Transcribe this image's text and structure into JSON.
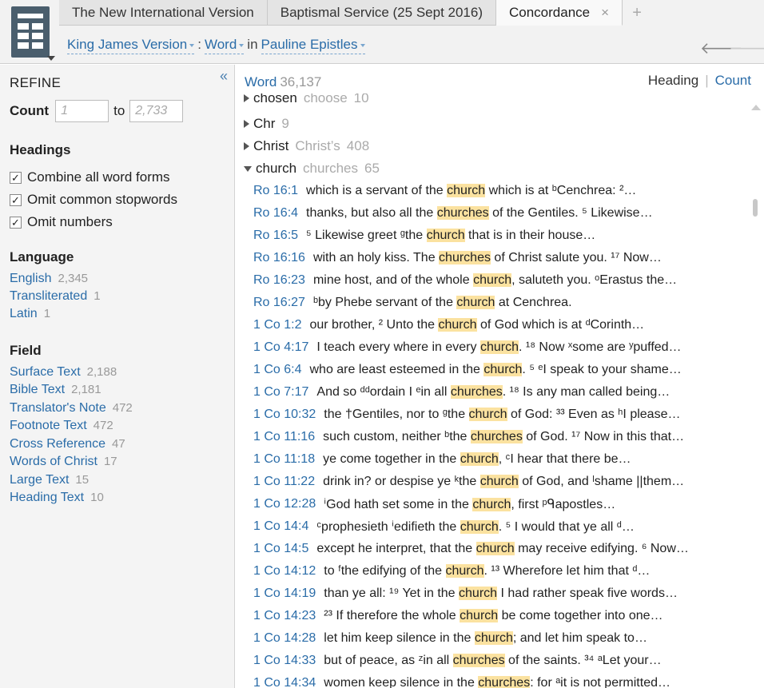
{
  "tabs": [
    {
      "label": "The New International Version"
    },
    {
      "label": "Baptismal Service (25 Sept 2016)"
    },
    {
      "label": "Concordance",
      "close": "×"
    }
  ],
  "tab_add": "+",
  "breadcrumb": {
    "version": "King James Version",
    "sep1": ":",
    "type": "Word",
    "sep2": "in",
    "scope": "Pauline Epistles"
  },
  "nav": {
    "back": "🡐",
    "forward": "🡒"
  },
  "sidebar": {
    "collapse": "«",
    "title": "REFINE",
    "count_label": "Count",
    "count_from_placeholder": "1",
    "count_to_label": "to",
    "count_to_placeholder": "2,733",
    "headings_title": "Headings",
    "options": [
      {
        "label": "Combine all word forms",
        "mark": "✓"
      },
      {
        "label": "Omit common stopwords",
        "mark": "✓"
      },
      {
        "label": "Omit numbers",
        "mark": "✓"
      }
    ],
    "language_title": "Language",
    "languages": [
      {
        "label": "English",
        "count": "2,345"
      },
      {
        "label": "Transliterated",
        "count": "1"
      },
      {
        "label": "Latin",
        "count": "1"
      }
    ],
    "field_title": "Field",
    "fields": [
      {
        "label": "Surface Text",
        "count": "2,188"
      },
      {
        "label": "Bible Text",
        "count": "2,181"
      },
      {
        "label": "Translator's Note",
        "count": "472"
      },
      {
        "label": "Footnote Text",
        "count": "472"
      },
      {
        "label": "Cross Reference",
        "count": "47"
      },
      {
        "label": "Words of Christ",
        "count": "17"
      },
      {
        "label": "Large Text",
        "count": "15"
      },
      {
        "label": "Heading Text",
        "count": "10"
      }
    ]
  },
  "main": {
    "head_label": "Word",
    "head_count": "36,137",
    "view_heading": "Heading",
    "view_sep": "|",
    "view_count": "Count"
  },
  "words": [
    {
      "word": "chosen",
      "alt": "choose",
      "count": "10"
    },
    {
      "word": "Chr",
      "alt": "",
      "count": "9"
    },
    {
      "word": "Christ",
      "alt": "Christ’s",
      "count": "408"
    },
    {
      "word": "church",
      "alt": "churches",
      "count": "65"
    }
  ],
  "refs": [
    {
      "ref": "Ro 16:1",
      "pre": "which is a servant of the ",
      "hl": "church",
      "post": " which is at ᵇCenchrea: ²…"
    },
    {
      "ref": "Ro 16:4",
      "pre": "thanks, but also all the ",
      "hl": "churches",
      "post": " of the Gentiles. ⁵ Likewise…"
    },
    {
      "ref": "Ro 16:5",
      "pre": "⁵ Likewise greet ᵍthe ",
      "hl": "church",
      "post": " that is in their house…"
    },
    {
      "ref": "Ro 16:16",
      "pre": "with an holy kiss. The ",
      "hl": "churches",
      "post": " of Christ salute you. ¹⁷ Now…"
    },
    {
      "ref": "Ro 16:23",
      "pre": "mine host, and of the whole ",
      "hl": "church",
      "post": ", saluteth you. ᵒErastus the…"
    },
    {
      "ref": "Ro 16:27",
      "pre": "ᵇby Phebe servant of the ",
      "hl": "church",
      "post": " at Cenchrea."
    },
    {
      "ref": "1 Co 1:2",
      "pre": "our brother, ² Unto the ",
      "hl": "church",
      "post": " of God which is at ᵈCorinth…"
    },
    {
      "ref": "1 Co 4:17",
      "pre": "I teach every where in every ",
      "hl": "church",
      "post": ". ¹⁸ Now ˣsome are ʸpuffed…"
    },
    {
      "ref": "1 Co 6:4",
      "pre": "who are least esteemed in the ",
      "hl": "church",
      "post": ". ⁵ ᵉI speak to your shame…"
    },
    {
      "ref": "1 Co 7:17",
      "pre": "And so ᵈᵈordain I ᵉin all ",
      "hl": "churches",
      "post": ". ¹⁸ Is any man called being…"
    },
    {
      "ref": "1 Co 10:32",
      "pre": "the †Gentiles, nor to ᵍthe ",
      "hl": "church",
      "post": " of God: ³³ Even as ʰI please…"
    },
    {
      "ref": "1 Co 11:16",
      "pre": "such custom, neither ᵇthe ",
      "hl": "churches",
      "post": " of God. ¹⁷ Now in this that…"
    },
    {
      "ref": "1 Co 11:18",
      "pre": "ye come together in the ",
      "hl": "church",
      "post": ", ᶜI hear that there be…"
    },
    {
      "ref": "1 Co 11:22",
      "pre": "drink in? or despise ye ᵏthe ",
      "hl": "church",
      "post": " of God, and ˡshame ||them…"
    },
    {
      "ref": "1 Co 12:28",
      "pre": "ⁱGod hath set some in the ",
      "hl": "church",
      "post": ", first ᵖᑫapostles…"
    },
    {
      "ref": "1 Co 14:4",
      "pre": "ᶜprophesieth ⁱedifieth the ",
      "hl": "church",
      "post": ". ⁵ I would that ye all ᵈ…"
    },
    {
      "ref": "1 Co 14:5",
      "pre": "except he interpret, that the ",
      "hl": "church",
      "post": " may receive edifying. ⁶ Now…"
    },
    {
      "ref": "1 Co 14:12",
      "pre": "to ᶠthe edifying of the ",
      "hl": "church",
      "post": ". ¹³ Wherefore let him that ᵈ…"
    },
    {
      "ref": "1 Co 14:19",
      "pre": "than ye all: ¹⁹ Yet in the ",
      "hl": "church",
      "post": " I had rather speak five words…"
    },
    {
      "ref": "1 Co 14:23",
      "pre": "²³ If therefore the whole ",
      "hl": "church",
      "post": " be come together into one…"
    },
    {
      "ref": "1 Co 14:28",
      "pre": "let him keep silence in the ",
      "hl": "church",
      "post": "; and let him speak to…"
    },
    {
      "ref": "1 Co 14:33",
      "pre": "but of peace, as ᶻin all ",
      "hl": "churches",
      "post": " of the saints. ³⁴ ᵃLet your…"
    },
    {
      "ref": "1 Co 14:34",
      "pre": "women keep silence in the ",
      "hl": "churches",
      "post": ": for ᵃit is not permitted…"
    }
  ]
}
